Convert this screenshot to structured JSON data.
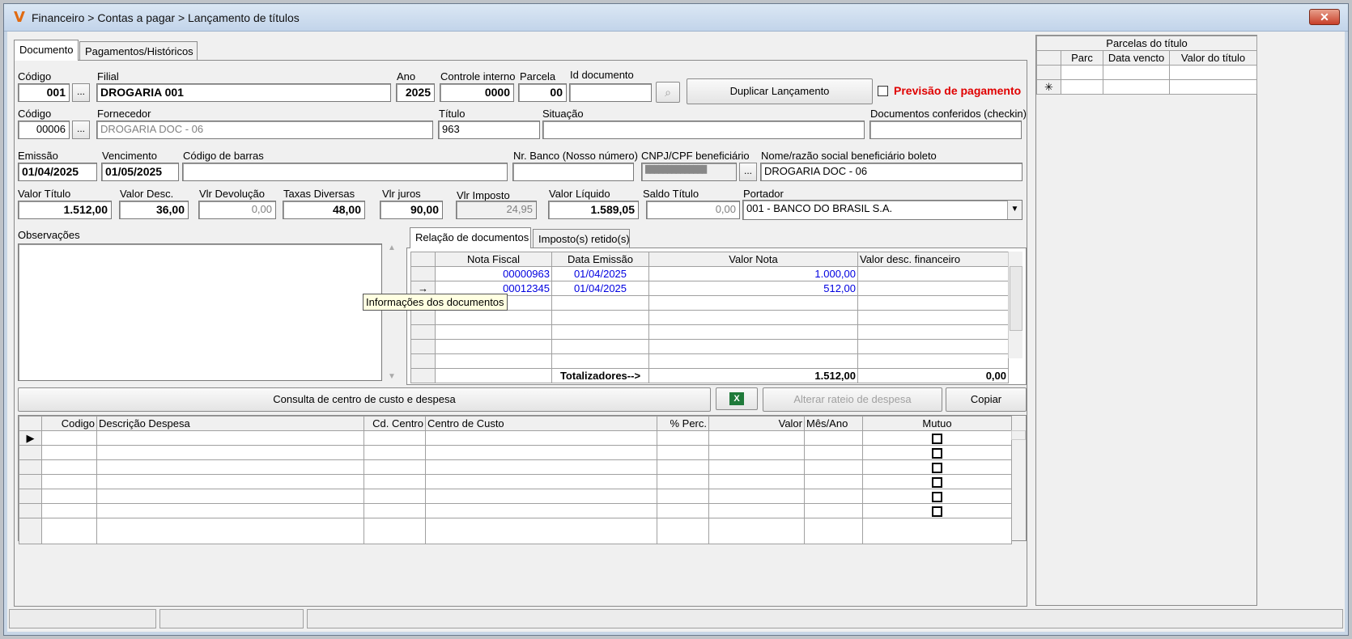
{
  "window": {
    "title": "Financeiro > Contas a pagar > Lançamento de títulos",
    "close_label": "✕"
  },
  "tabs": [
    "Documento",
    "Pagamentos/Históricos"
  ],
  "header": {
    "codigo_label": "Código",
    "codigo": "001",
    "filial_label": "Filial",
    "filial": "DROGARIA 001",
    "ano_label": "Ano",
    "ano": "2025",
    "controle_label": "Controle interno",
    "controle": "0000",
    "parcela_label": "Parcela",
    "parcela": "00",
    "id_doc_label": "Id documento",
    "id_doc": "",
    "duplicar_label": "Duplicar Lançamento",
    "previsao_label": "Previsão de pagamento",
    "fornecedor_codigo_label": "Código",
    "fornecedor_codigo": "00006",
    "fornecedor_label": "Fornecedor",
    "fornecedor": "DROGARIA DOC - 06",
    "titulo_label": "Título",
    "titulo": "963",
    "situacao_label": "Situação",
    "situacao": "",
    "docs_conferidos_label": "Documentos conferidos (checkin)",
    "docs_conferidos": "",
    "emissao_label": "Emissão",
    "emissao": "01/04/2025",
    "vencimento_label": "Vencimento",
    "vencimento": "01/05/2025",
    "codigo_barras_label": "Código de barras",
    "codigo_barras": "",
    "nr_banco_label": "Nr. Banco (Nosso número)",
    "nr_banco": "",
    "cnpj_label": "CNPJ/CPF beneficiário",
    "cnpj": "██████████████",
    "nome_benef_label": "Nome/razão social beneficiário boleto",
    "nome_benef": "DROGARIA DOC - 06",
    "valor_titulo_label": "Valor Título",
    "valor_titulo": "1.512,00",
    "valor_desc_label": "Valor Desc.",
    "valor_desc": "36,00",
    "vlr_devolucao_label": "Vlr Devolução",
    "vlr_devolucao": "0,00",
    "taxas_label": "Taxas Diversas",
    "taxas": "48,00",
    "vlr_juros_label": "Vlr juros",
    "vlr_juros": "90,00",
    "vlr_imposto_label": "Vlr Imposto",
    "vlr_imposto": "24,95",
    "valor_liquido_label": "Valor Líquido",
    "valor_liquido": "1.589,05",
    "saldo_label": "Saldo Título",
    "saldo": "0,00",
    "portador_label": "Portador",
    "portador": "001 - BANCO DO BRASIL S.A.",
    "observacoes_label": "Observações"
  },
  "doc_tabs": [
    "Relação de documentos",
    "Imposto(s) retido(s)"
  ],
  "docs_grid": {
    "columns": [
      "Nota Fiscal",
      "Data Emissão",
      "Valor Nota",
      "Valor desc. financeiro"
    ],
    "rows": [
      {
        "nota": "00000963",
        "data": "01/04/2025",
        "valor": "1.000,00",
        "desc": ""
      },
      {
        "nota": "00012345",
        "data": "01/04/2025",
        "valor": "512,00",
        "desc": ""
      }
    ],
    "totals_label": "Totalizadores-->",
    "total_valor": "1.512,00",
    "total_desc": "0,00",
    "row_marker": "→"
  },
  "tooltip": "Informações dos documentos",
  "actions": {
    "consulta": "Consulta de centro de custo e despesa",
    "alterar": "Alterar rateio de despesa",
    "copiar": "Copiar",
    "excel_icon": "X"
  },
  "expense_grid": {
    "columns": [
      "Codigo",
      "Descrição Despesa",
      "Cd. Centro",
      "Centro de Custo",
      "% Perc.",
      "Valor",
      "Mês/Ano",
      "Mutuo"
    ],
    "row_count": 6
  },
  "parcelas": {
    "title": "Parcelas do título",
    "columns": [
      "Parc",
      "Data vencto",
      "Valor do título"
    ],
    "new_row_marker": "✳"
  }
}
